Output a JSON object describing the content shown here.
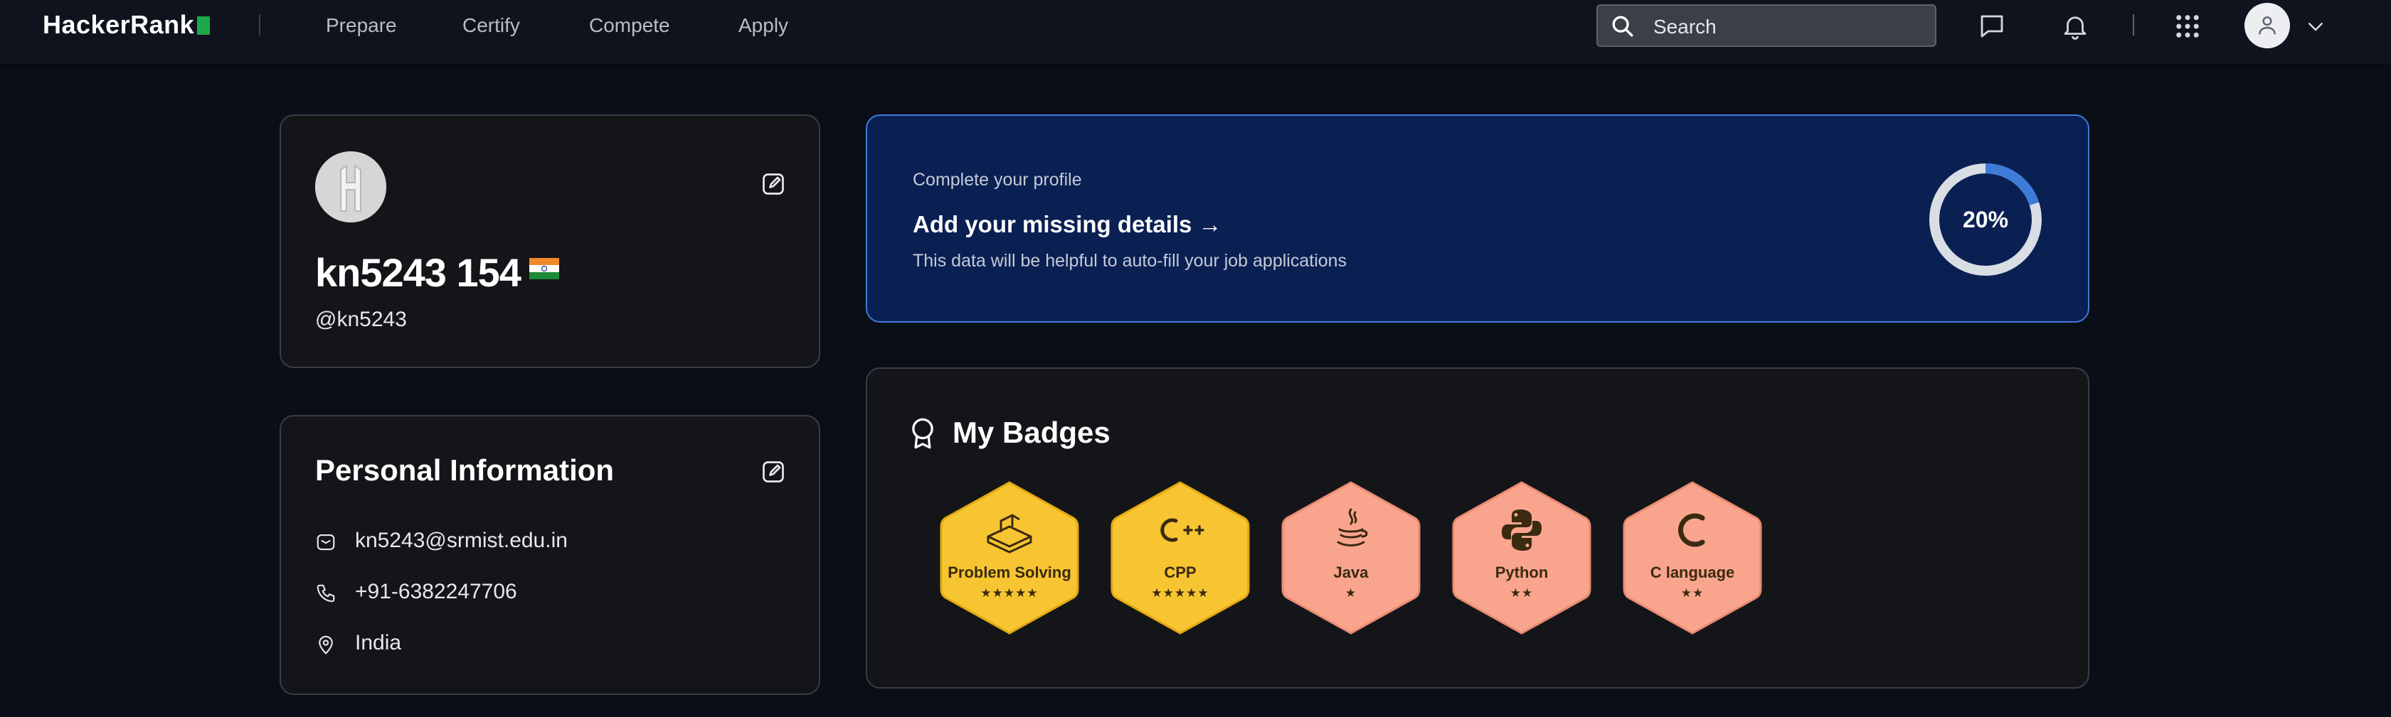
{
  "header": {
    "logo": "HackerRank",
    "nav": [
      "Prepare",
      "Certify",
      "Compete",
      "Apply"
    ],
    "search_placeholder": "Search",
    "icons": [
      "search-icon",
      "message-icon",
      "bell-icon",
      "apps-grid-icon",
      "user-icon",
      "chevron-down-icon"
    ]
  },
  "profile": {
    "name": "kn5243 154",
    "handle": "@kn5243",
    "country_flag": "india-flag"
  },
  "profile_completion": {
    "subtitle": "Complete your profile",
    "title": "Add your missing details →",
    "description": "This data will be helpful to auto-fill your job applications",
    "progress_label": "20%",
    "progress_value": 0.2
  },
  "personal_info": {
    "title": "Personal Information",
    "email": "kn5243@srmist.edu.in",
    "phone": "+91-6382247706",
    "location": "India"
  },
  "badges": {
    "title": "My Badges",
    "items": [
      {
        "name": "Problem Solving",
        "stars": "★★★★★",
        "tier": "gold",
        "star_count": 5
      },
      {
        "name": "CPP",
        "stars": "★★★★★",
        "tier": "gold",
        "star_count": 5
      },
      {
        "name": "Java",
        "stars": "★",
        "tier": "bronze",
        "star_count": 1
      },
      {
        "name": "Python",
        "stars": "★★",
        "tier": "bronze",
        "star_count": 2
      },
      {
        "name": "C language",
        "stars": "★★",
        "tier": "bronze",
        "star_count": 2
      }
    ]
  },
  "colors": {
    "background": "#0a0e17",
    "brand_green": "#1ba94c",
    "accent_blue": "#3d7bd8",
    "gold_badge": "#f7c531",
    "bronze_badge": "#f9a58e"
  }
}
